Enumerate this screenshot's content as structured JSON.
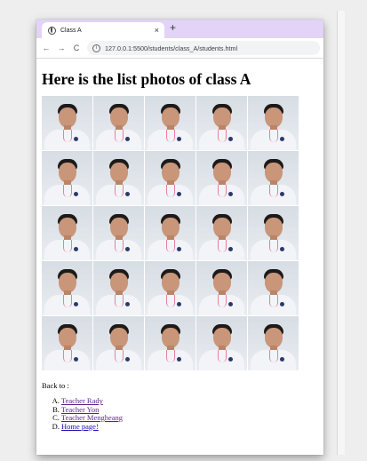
{
  "browser": {
    "tab_title": "Class A",
    "close_symbol": "×",
    "new_tab_symbol": "+",
    "back_symbol": "←",
    "forward_symbol": "→",
    "reload_symbol": "C",
    "url": "127.0.0.1:5500/students/class_A/students.html"
  },
  "page": {
    "heading": "Here is the list photos of class A",
    "back_label": "Back to :",
    "links": [
      {
        "label": "Teacher Rady"
      },
      {
        "label": "Teacher Yon"
      },
      {
        "label": "Teacher Mengheang"
      },
      {
        "label": "Home page!"
      }
    ]
  },
  "photos": {
    "rows": 5,
    "columns": 5,
    "count": 25,
    "subject": "student portrait"
  },
  "colors": {
    "tabstrip": "#e2d3f7",
    "visited_link": "#5a1f8a",
    "link": "#1a0dab"
  }
}
